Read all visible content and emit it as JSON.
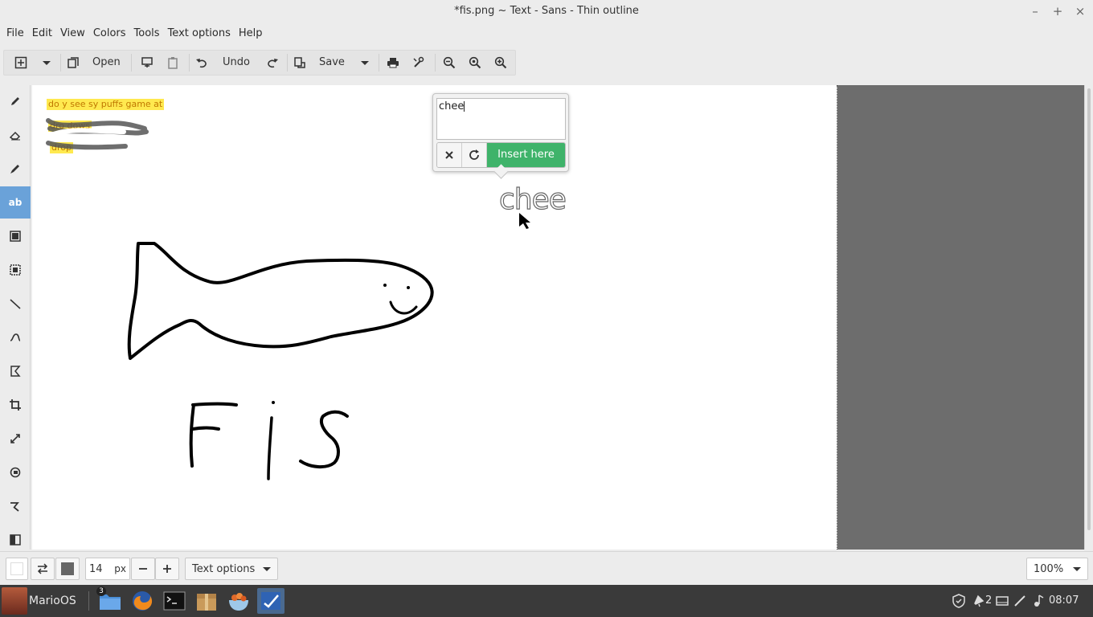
{
  "window": {
    "title": "*fis.png ~ Text - Sans - Thin outline"
  },
  "menu": [
    "File",
    "Edit",
    "View",
    "Colors",
    "Tools",
    "Text options",
    "Help"
  ],
  "toolbar": {
    "open_label": "Open",
    "undo_label": "Undo",
    "save_label": "Save"
  },
  "canvas": {
    "drawn_text": "Fis",
    "highlight_lines": [
      "do y      see  sy puffs game at",
      "dro          dows",
      "drop      "
    ]
  },
  "text_popover": {
    "input_value": "chee",
    "insert_label": "Insert here",
    "preview_text": "chee"
  },
  "bottombar": {
    "size_value": "14",
    "size_unit": "px",
    "text_options_label": "Text options",
    "zoom_value": "100%"
  },
  "taskbar": {
    "start_label": "MarioOS",
    "folder_badge": "3",
    "notif_count": "2",
    "clock": "08:07"
  },
  "colors": {
    "accent_active_tool": "#6aa2d9",
    "insert_button": "#3fb36a",
    "highlight": "#ffe94f"
  }
}
